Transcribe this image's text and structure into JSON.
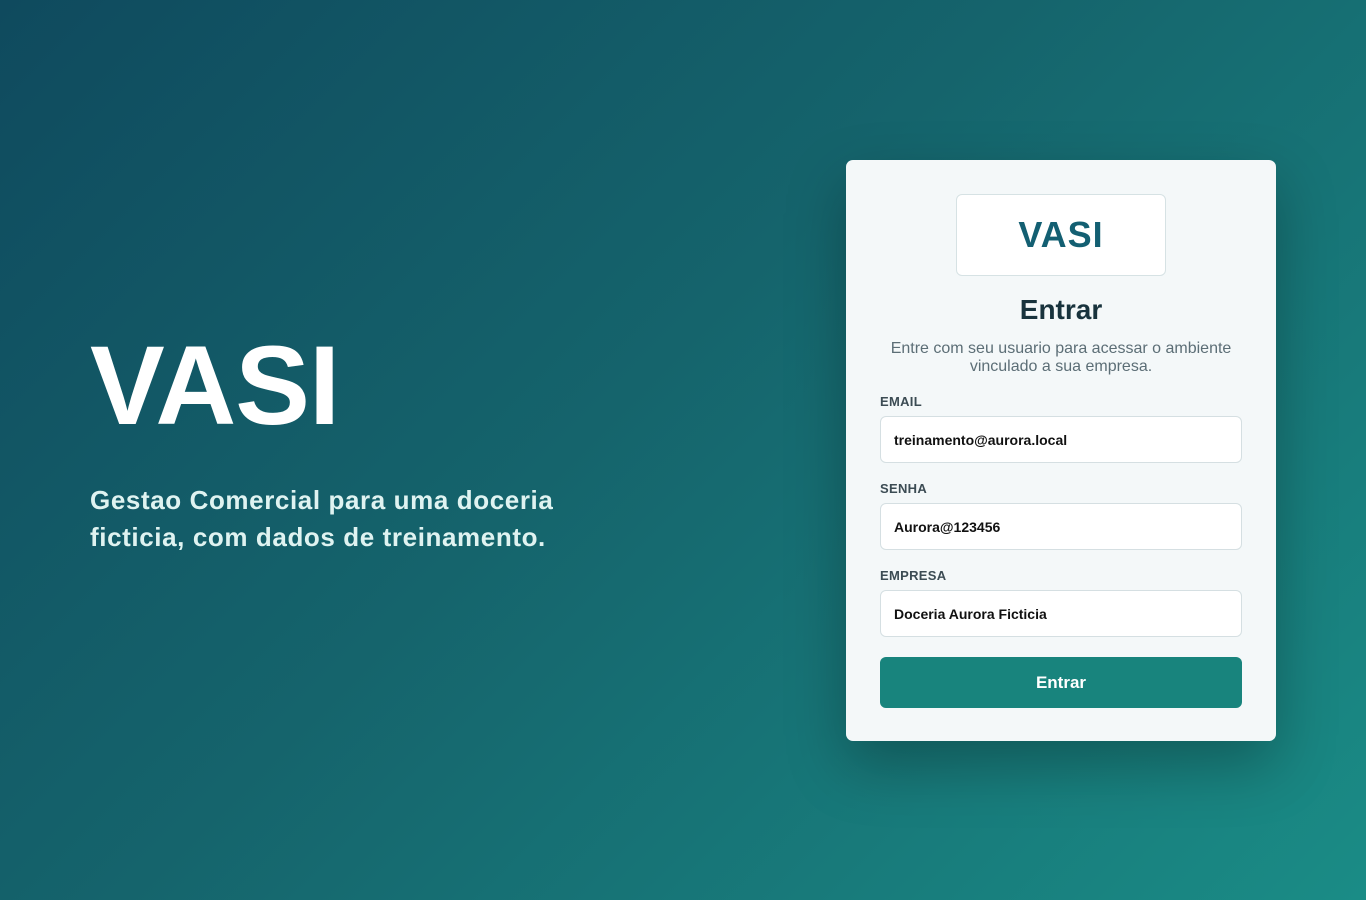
{
  "hero": {
    "title": "VASI",
    "subtitle": "Gestao Comercial para uma doceria ficticia, com dados de treinamento."
  },
  "login": {
    "logo_text": "VASI",
    "title": "Entrar",
    "description": "Entre com seu usuario para acessar o ambiente vinculado a sua empresa.",
    "fields": {
      "email": {
        "label": "EMAIL",
        "value": "treinamento@aurora.local"
      },
      "senha": {
        "label": "SENHA",
        "value": "Aurora@123456"
      },
      "empresa": {
        "label": "EMPRESA",
        "value": "Doceria Aurora Ficticia"
      }
    },
    "submit_label": "Entrar"
  },
  "colors": {
    "background_start": "#0f4a5e",
    "background_end": "#1a8c86",
    "card_background": "#f4f8f9",
    "logo_text": "#135f72",
    "button": "#18847d"
  }
}
